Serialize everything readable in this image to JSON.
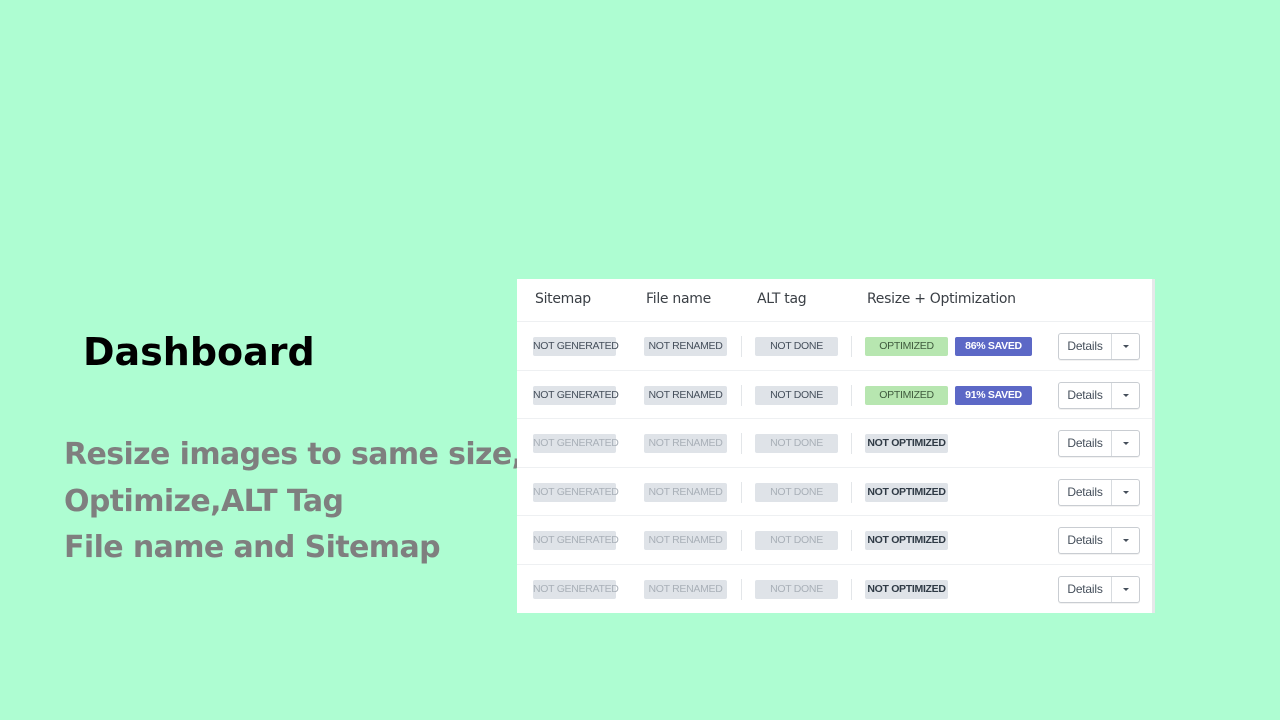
{
  "slide": {
    "title": "Dashboard",
    "description_lines": [
      "Resize images to same size,",
      "Optimize,ALT Tag",
      "File name and Sitemap"
    ]
  },
  "table": {
    "headers": {
      "sitemap": "Sitemap",
      "file_name": "File name",
      "alt_tag": "ALT tag",
      "resize": "Resize + Optimization"
    },
    "rows": [
      {
        "sitemap": "NOT GENERATED",
        "file_name": "NOT RENAMED",
        "alt_tag": "NOT DONE",
        "optimization": "OPTIMIZED",
        "saved": "86% SAVED",
        "details_label": "Details",
        "faded": false
      },
      {
        "sitemap": "NOT GENERATED",
        "file_name": "NOT RENAMED",
        "alt_tag": "NOT DONE",
        "optimization": "OPTIMIZED",
        "saved": "91% SAVED",
        "details_label": "Details",
        "faded": false
      },
      {
        "sitemap": "NOT GENERATED",
        "file_name": "NOT RENAMED",
        "alt_tag": "NOT DONE",
        "optimization": "NOT OPTIMIZED",
        "saved": null,
        "details_label": "Details",
        "faded": true
      },
      {
        "sitemap": "NOT GENERATED",
        "file_name": "NOT RENAMED",
        "alt_tag": "NOT DONE",
        "optimization": "NOT OPTIMIZED",
        "saved": null,
        "details_label": "Details",
        "faded": true
      },
      {
        "sitemap": "NOT GENERATED",
        "file_name": "NOT RENAMED",
        "alt_tag": "NOT DONE",
        "optimization": "NOT OPTIMIZED",
        "saved": null,
        "details_label": "Details",
        "faded": true
      },
      {
        "sitemap": "NOT GENERATED",
        "file_name": "NOT RENAMED",
        "alt_tag": "NOT DONE",
        "optimization": "NOT OPTIMIZED",
        "saved": null,
        "details_label": "Details",
        "faded": true
      }
    ]
  },
  "colors": {
    "background": "#aefdd2",
    "optimized_badge": "#b7e6b0",
    "saved_badge": "#5c68c6",
    "neutral_badge": "#dfe3e8"
  }
}
